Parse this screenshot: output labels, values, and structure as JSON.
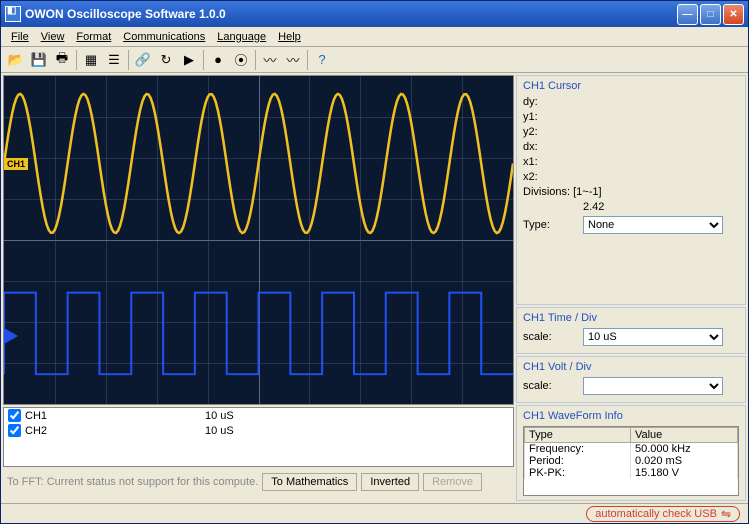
{
  "window": {
    "title": "OWON Oscilloscope Software 1.0.0"
  },
  "menu": {
    "file": "File",
    "view": "View",
    "format": "Format",
    "communications": "Communications",
    "language": "Language",
    "help": "Help"
  },
  "channels": {
    "ch1": {
      "name": "CH1",
      "timediv": "10 uS",
      "checked": true
    },
    "ch2": {
      "name": "CH2",
      "timediv": "10 uS",
      "checked": true
    }
  },
  "cursor": {
    "title": "CH1 Cursor",
    "dy": "dy:",
    "y1": "y1:",
    "y2": "y2:",
    "dx": "dx:",
    "x1": "x1:",
    "x2": "x2:",
    "divisions_label": "Divisions: [1~-1]",
    "divisions_value": "2.42",
    "type_label": "Type:",
    "type_value": "None"
  },
  "timediv": {
    "title": "CH1 Time / Div",
    "scale_label": "scale:",
    "scale_value": "10 uS"
  },
  "voltdiv": {
    "title": "CH1 Volt / Div",
    "scale_label": "scale:",
    "scale_value": ""
  },
  "waveinfo": {
    "title": "CH1 WaveForm Info",
    "col_type": "Type",
    "col_value": "Value",
    "rows": {
      "freq_label": "Frequency:",
      "freq_value": "50.000 kHz",
      "period_label": "Period:",
      "period_value": "0.020 mS",
      "pkpk_label": "PK-PK:",
      "pkpk_value": "15.180 V"
    }
  },
  "bottom": {
    "fft_msg": "To FFT: Current status not support for this compute.",
    "to_math": "To Mathematics",
    "inverted": "Inverted",
    "remove": "Remove"
  },
  "status": {
    "auto_check": "automatically check USB"
  },
  "ch1_badge": "CH1",
  "chart_data": {
    "type": "line",
    "title": "Oscilloscope capture",
    "timebase_per_div_us": 10,
    "series": [
      {
        "name": "CH1",
        "waveform": "sine",
        "color": "#f0c020",
        "frequency_khz": 50.0,
        "period_ms": 0.02,
        "pkpk_v": 15.18,
        "cycles_visible": 8
      },
      {
        "name": "CH2",
        "waveform": "square",
        "color": "#2050f0",
        "frequency_khz": 50.0,
        "period_ms": 0.02,
        "cycles_visible": 8
      }
    ]
  }
}
